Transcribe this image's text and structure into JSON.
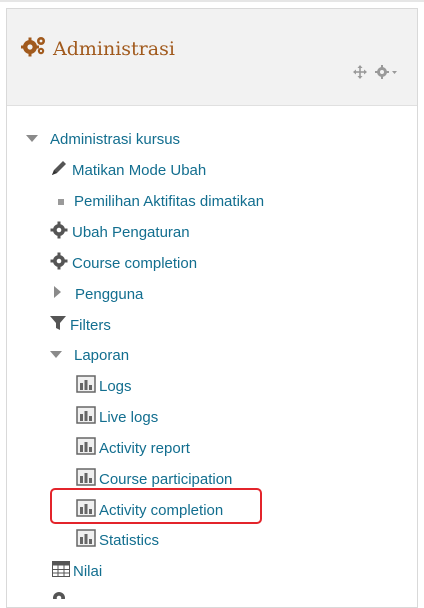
{
  "block": {
    "title": "Administrasi",
    "title_icon": "gears-icon",
    "action_icons": [
      "move-icon",
      "gear-menu-icon"
    ]
  },
  "colors": {
    "link": "#126e8f",
    "title": "#a15a1d",
    "icon_gray": "#555555",
    "highlight": "#e3242b"
  },
  "tree": {
    "course_admin": "Administrasi kursus",
    "turn_editing_off": "Matikan Mode Ubah",
    "activity_chooser_off": "Pemilihan Aktifitas dimatikan",
    "edit_settings": "Ubah Pengaturan",
    "course_completion": "Course completion",
    "users": "Pengguna",
    "filters": "Filters",
    "reports": "Laporan",
    "logs": "Logs",
    "live_logs": "Live logs",
    "activity_report": "Activity report",
    "course_participation": "Course participation",
    "activity_completion": "Activity completion",
    "statistics": "Statistics",
    "grades": "Nilai"
  }
}
